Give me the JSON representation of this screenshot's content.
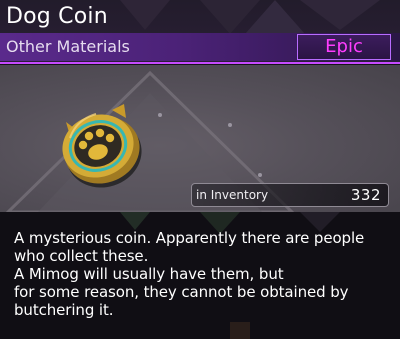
{
  "item": {
    "name": "Dog Coin",
    "category": "Other Materials",
    "rarity": "Epic",
    "rarity_color": "#ff3dff",
    "accent_color": "#c64bff",
    "icon": "dog-coin-icon"
  },
  "inventory": {
    "label": "in Inventory",
    "count": "332"
  },
  "description": "A mysterious coin. Apparently there are people who collect these.\nA Mimog will usually have them, but\nfor some reason, they cannot be obtained by butchering it."
}
